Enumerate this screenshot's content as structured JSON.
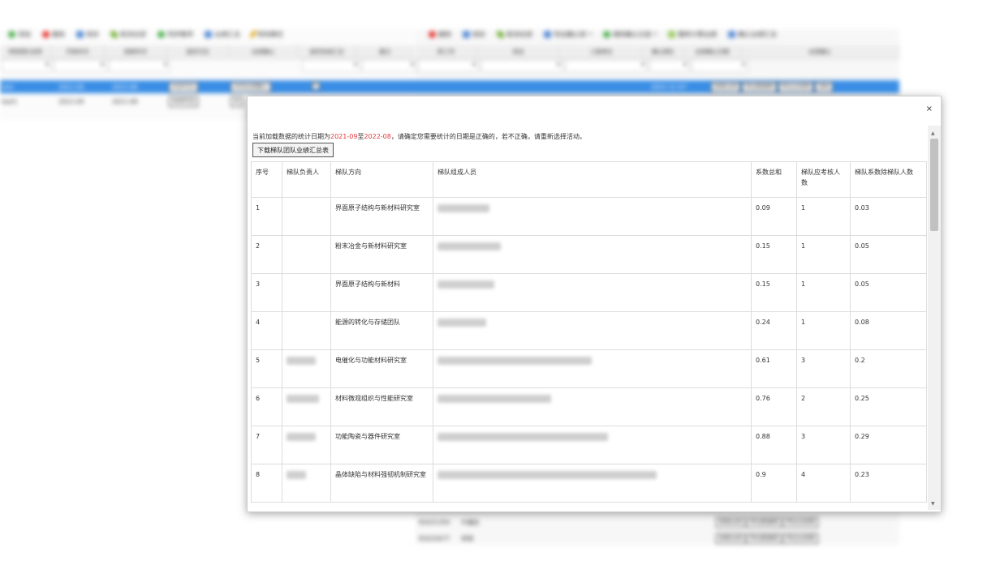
{
  "left_toolbar": [
    "添加",
    "删除",
    "保存",
    "取消全部",
    "同步教师",
    "业绩汇总",
    "修改模式"
  ],
  "right_toolbar": [
    "删除",
    "保存",
    "取消全部",
    "导出确认表",
    "清除确认记录",
    "重新计算业绩",
    "确认业绩汇总"
  ],
  "left_headers": [
    "考核团队名称",
    "开始年月",
    "结束年月",
    "是否可见",
    "业绩确认",
    "是否完成汇总",
    "备注"
  ],
  "right_headers": [
    "职工号",
    "姓名",
    "三级单位",
    "确认团队",
    "业绩确认日期",
    "业绩确认"
  ],
  "left_rows": [
    {
      "name": "test",
      "start": "2021-09",
      "end": "2022-08",
      "visible_btn": "关闭可见",
      "confirm_btn": "关闭业绩确认",
      "selected": true
    },
    {
      "name": "test1",
      "start": "2022-09",
      "end": "2021-08",
      "visible_btn": "关闭可见",
      "confirm_btn": "关",
      "selected": false
    }
  ],
  "right_first_row": {
    "date": "2022-11-07"
  },
  "row_buttons": {
    "view": "查看业绩",
    "export_data": "导出数据表",
    "export_perf": "导出业绩表",
    "clear": "清除"
  },
  "bottom_rows": [
    {
      "id": "81631354",
      "name": "牛重民"
    },
    {
      "id": "81632677",
      "name": "李琪"
    }
  ],
  "modal": {
    "close": "×",
    "notice_pre": "当前加载数据的统计日期为",
    "start": "2021-09",
    "notice_mid": "至",
    "end": "2022-08",
    "notice_post": "，请确定您需要统计的日期是正确的，若不正确，请重新选择活动。",
    "download_btn": "下载梯队团队业绩汇总表",
    "headers": [
      "序号",
      "梯队负责人",
      "梯队方向",
      "梯队组成人员",
      "系数总和",
      "梯队应考核人数",
      "梯队系数除梯队人数"
    ],
    "rows": [
      {
        "no": "1",
        "direction": "界面原子结构与新材料研究室",
        "total": "0.09",
        "count": "1",
        "ratio": "0.03"
      },
      {
        "no": "2",
        "direction": "粉末冶金与新材料研究室",
        "total": "0.15",
        "count": "1",
        "ratio": "0.05"
      },
      {
        "no": "3",
        "direction": "界面原子结构与新材料",
        "total": "0.15",
        "count": "1",
        "ratio": "0.05"
      },
      {
        "no": "4",
        "direction": "能源的转化与存储团队",
        "total": "0.24",
        "count": "1",
        "ratio": "0.08"
      },
      {
        "no": "5",
        "direction": "电催化与功能材料研究室",
        "total": "0.61",
        "count": "3",
        "ratio": "0.2"
      },
      {
        "no": "6",
        "direction": "材料微观组织与性能研究室",
        "total": "0.76",
        "count": "2",
        "ratio": "0.25"
      },
      {
        "no": "7",
        "direction": "功能陶瓷与器件研究室",
        "total": "0.88",
        "count": "3",
        "ratio": "0.29"
      },
      {
        "no": "8",
        "direction": "晶体缺陷与材料强韧机制研究室",
        "total": "0.9",
        "count": "4",
        "ratio": "0.23"
      }
    ]
  },
  "colors": {
    "selection": "#3a8ee6",
    "highlight": "#e53935",
    "scroll_thumb": "#c1c1c1"
  }
}
